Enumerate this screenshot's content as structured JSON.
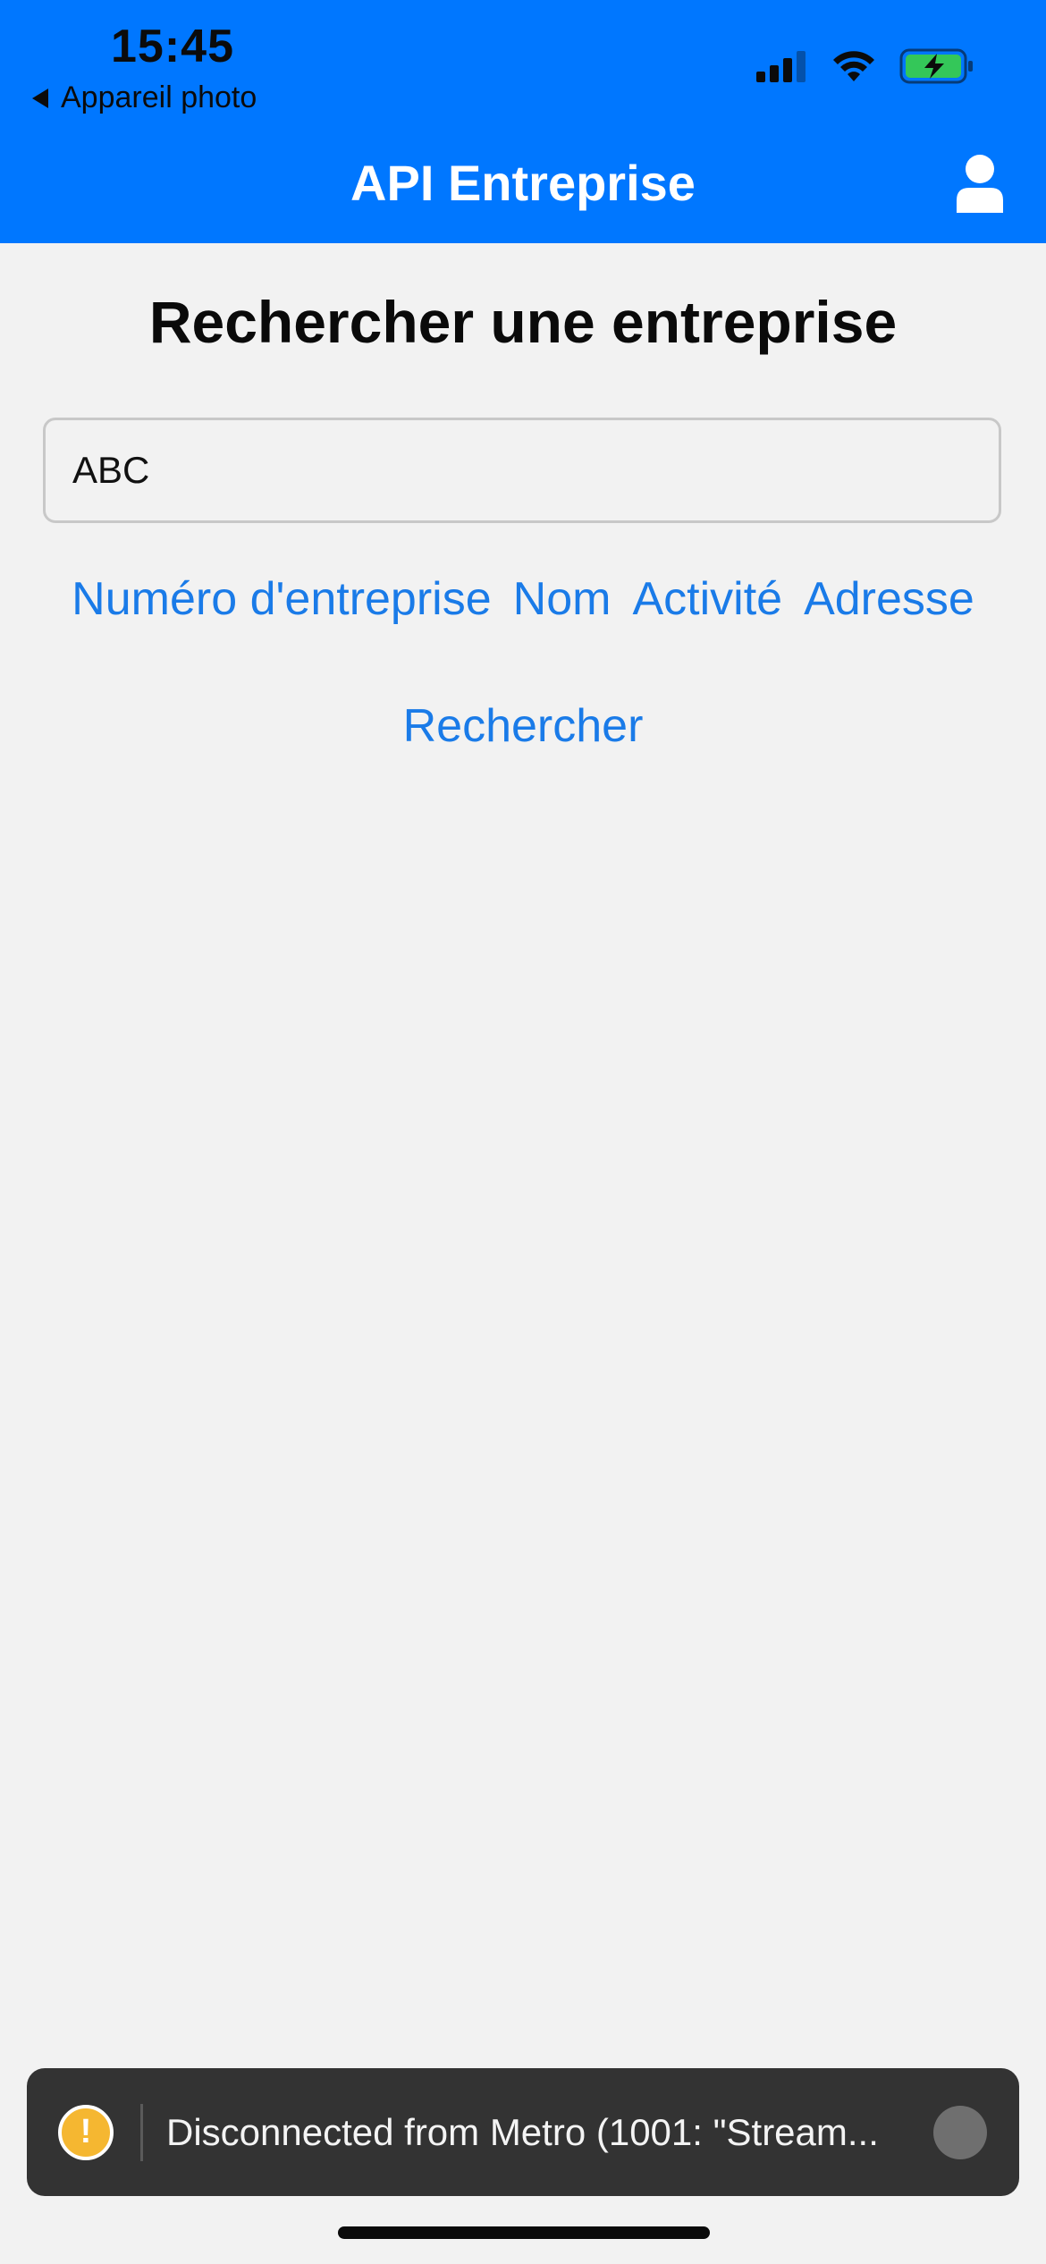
{
  "status_bar": {
    "time": "15:45",
    "back_app_label": "Appareil photo",
    "icons": [
      "cellular-signal-icon",
      "wifi-icon",
      "battery-charging-icon"
    ]
  },
  "nav": {
    "title": "API Entreprise",
    "profile_icon": "user-icon"
  },
  "main": {
    "title": "Rechercher une entreprise",
    "search_value": "ABC",
    "filters": [
      {
        "label": "Numéro d'entreprise"
      },
      {
        "label": "Nom"
      },
      {
        "label": "Activité"
      },
      {
        "label": "Adresse"
      }
    ],
    "search_button": "Rechercher"
  },
  "toast": {
    "icon": "warning-icon",
    "message": "Disconnected from Metro (1001: \"Stream..."
  },
  "colors": {
    "header": "#0077ff",
    "link": "#1a7be8",
    "background": "#f2f2f2",
    "toast_bg": "#333333",
    "warning": "#f5b731"
  }
}
